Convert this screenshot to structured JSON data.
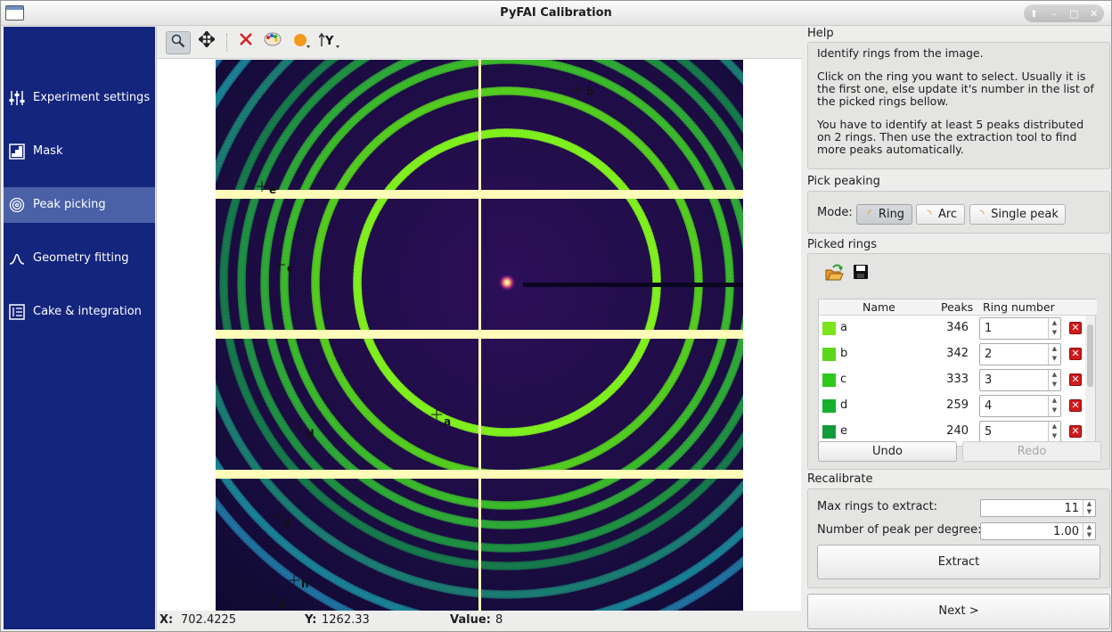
{
  "window": {
    "title": "PyFAI Calibration",
    "controls": [
      "⬆",
      "–",
      "□",
      "✕"
    ]
  },
  "sidebar": {
    "items": [
      {
        "label": "Experiment settings",
        "icon": "sliders-icon"
      },
      {
        "label": "Mask",
        "icon": "mask-icon"
      },
      {
        "label": "Peak picking",
        "icon": "rings-icon"
      },
      {
        "label": "Geometry fitting",
        "icon": "peak-curve-icon"
      },
      {
        "label": "Cake & integration",
        "icon": "cake-icon"
      }
    ],
    "active_index": 2
  },
  "plot": {
    "toolbar": [
      "zoom-icon",
      "pan-icon",
      "clear-icon",
      "colormap-icon",
      "marker-icon",
      "y-axis-icon"
    ],
    "ring_labels": [
      "b",
      "e",
      "c",
      "a",
      "d",
      "g",
      "h",
      "k"
    ],
    "status": {
      "x_label": "X:",
      "x_value": "702.4225",
      "y_label": "Y:",
      "y_value": "1262.33",
      "value_label": "Value:",
      "value": "8"
    }
  },
  "help": {
    "title": "Help",
    "paragraphs": [
      "Identify rings from the image.",
      "Click on the ring you want to select. Usually it is the first one, else update it's number in the list of the picked rings bellow.",
      "You have to identify at least 5 peaks distributed on 2 rings. Then use the extraction tool to find more peaks automatically."
    ]
  },
  "pick": {
    "title": "Pick peaking",
    "mode_label": "Mode:",
    "modes": [
      "Ring",
      "Arc",
      "Single peak"
    ],
    "selected_mode": "Ring"
  },
  "picked": {
    "title": "Picked rings",
    "headers": {
      "name": "Name",
      "peaks": "Peaks",
      "ring": "Ring number"
    },
    "rows": [
      {
        "name": "a",
        "peaks": "346",
        "ring": "1",
        "color": "#7ce41c"
      },
      {
        "name": "b",
        "peaks": "342",
        "ring": "2",
        "color": "#5cd61c"
      },
      {
        "name": "c",
        "peaks": "333",
        "ring": "3",
        "color": "#2ec81c"
      },
      {
        "name": "d",
        "peaks": "259",
        "ring": "4",
        "color": "#17b02e"
      },
      {
        "name": "e",
        "peaks": "240",
        "ring": "5",
        "color": "#129a3c"
      }
    ],
    "undo": "Undo",
    "redo": "Redo"
  },
  "recal": {
    "title": "Recalibrate",
    "max_rings_label": "Max rings to extract:",
    "max_rings": "11",
    "peaks_per_degree_label": "Number of peak per degree:",
    "peaks_per_degree": "1.00",
    "extract": "Extract"
  },
  "next": "Next >"
}
